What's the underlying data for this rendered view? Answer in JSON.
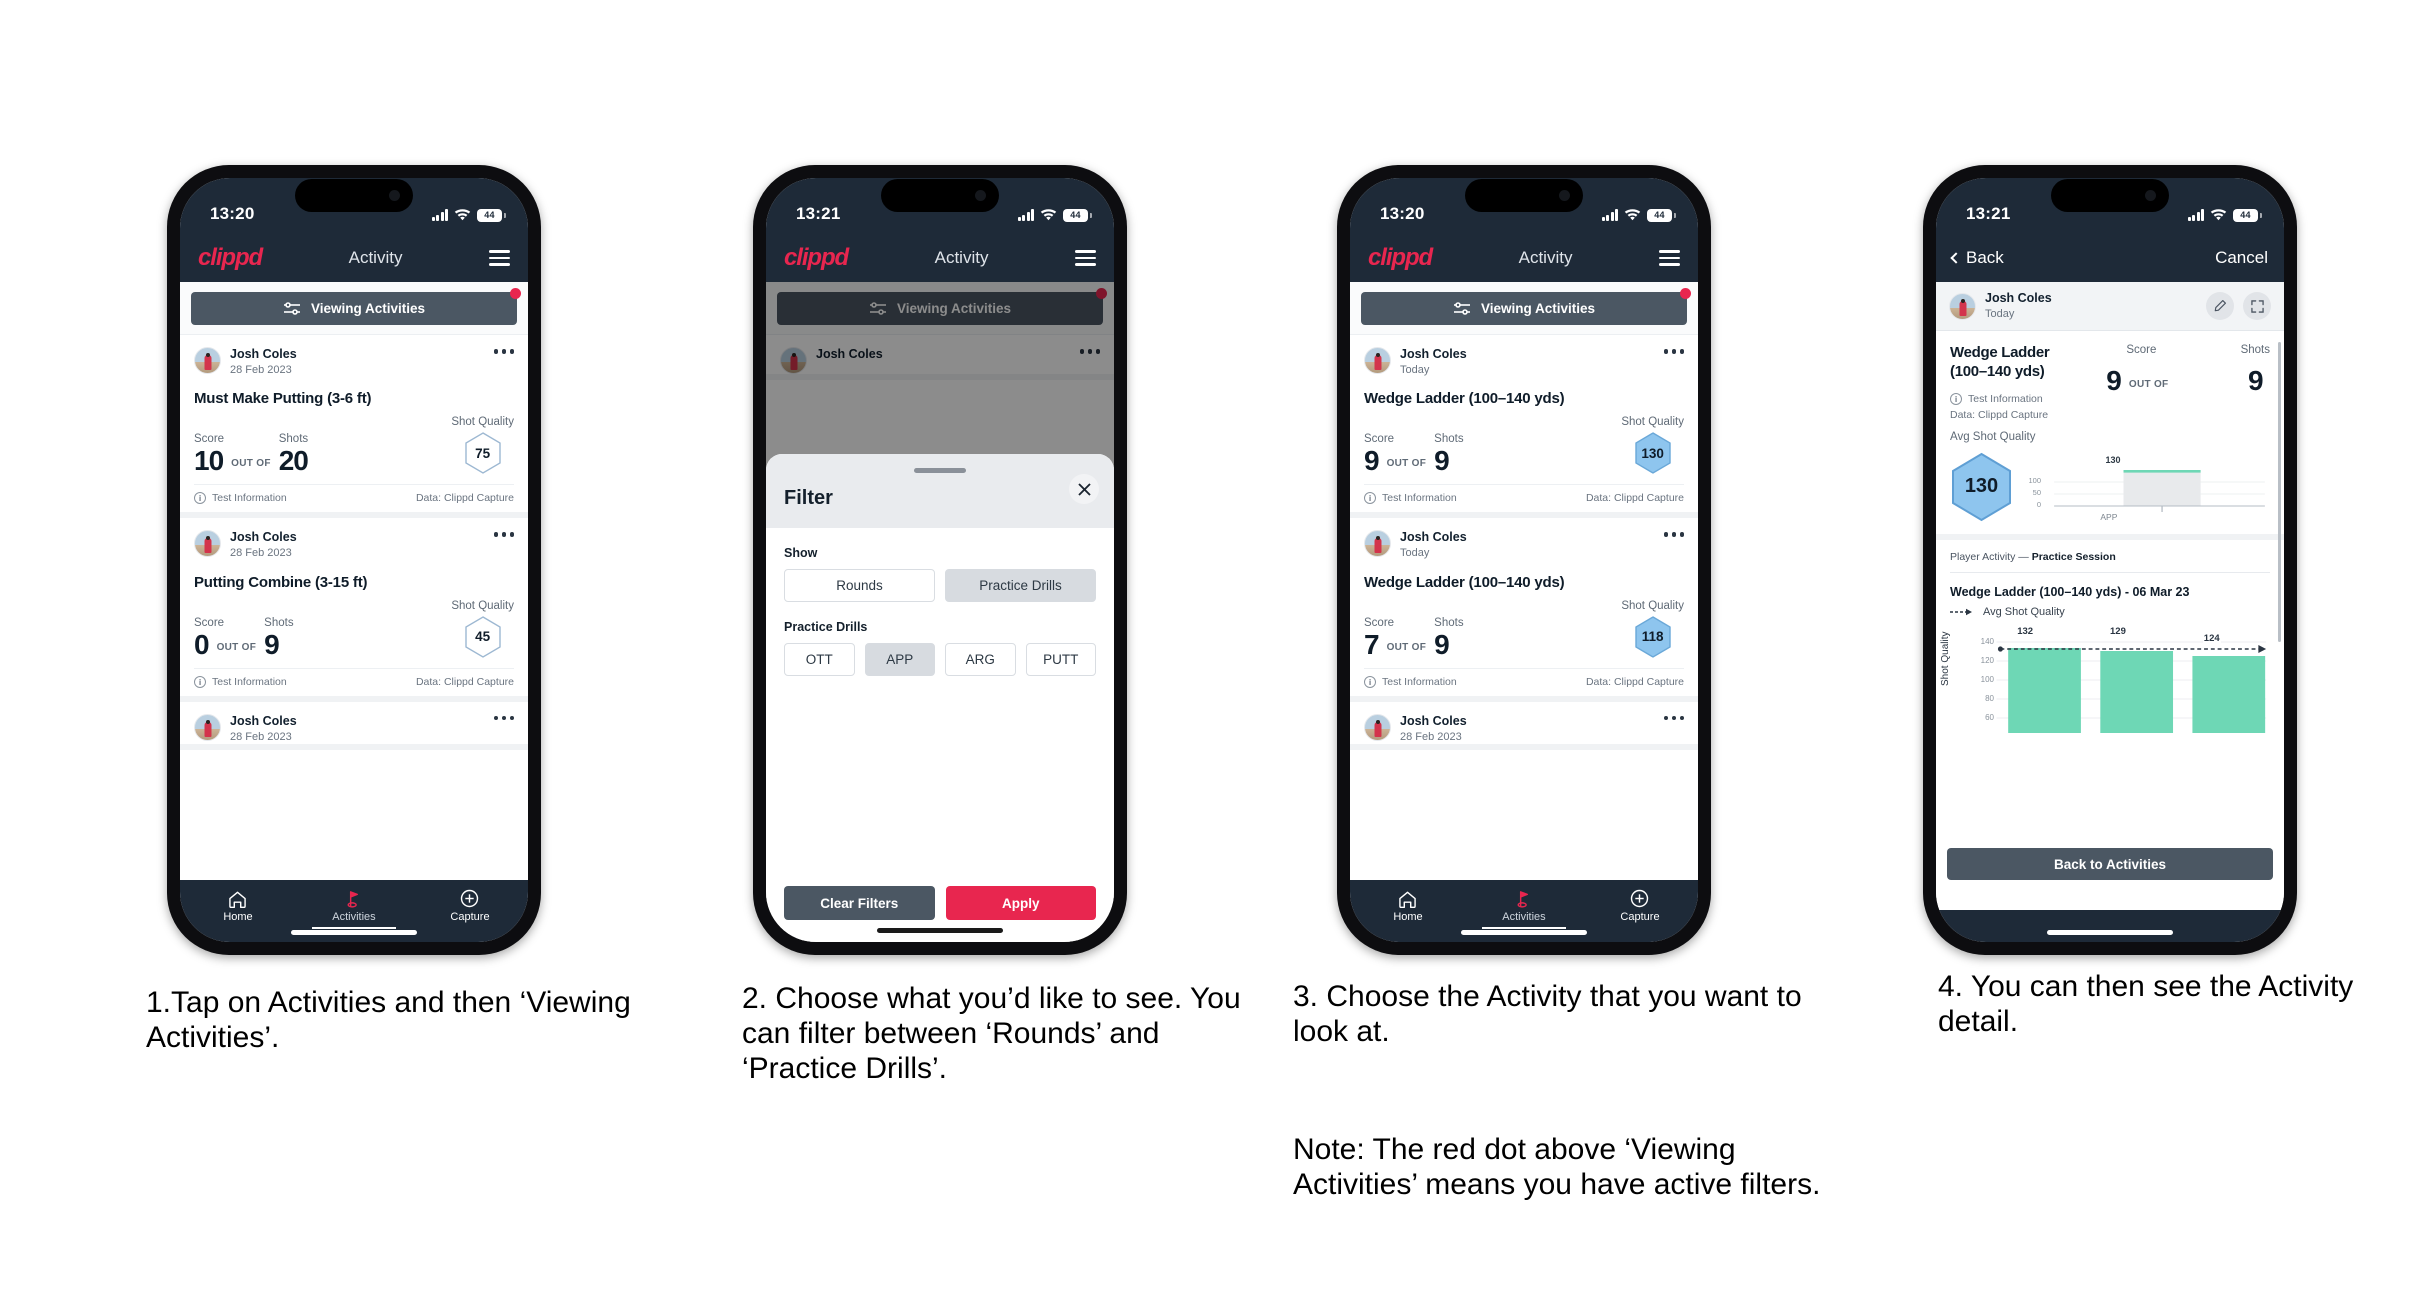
{
  "page": {
    "background": "#ffffff",
    "brand_color": "#e8264f",
    "dark_color": "#1e2a38"
  },
  "phones": [
    {
      "id": "phone-1",
      "status": {
        "time": "13:20",
        "battery": "44"
      },
      "appbar": {
        "logo": "clippd",
        "title": "Activity",
        "menu_icon": "hamburger-icon"
      },
      "filterbar": {
        "label": "Viewing Activities",
        "icon": "sliders-icon",
        "has_badge": true
      },
      "cards": [
        {
          "user": "Josh Coles",
          "date": "28 Feb 2023",
          "title": "Must Make Putting (3-6 ft)",
          "score_label": "Score",
          "score": "10",
          "outof_label": "OUT OF",
          "shots_label": "Shots",
          "shots": "20",
          "quality_label": "Shot Quality",
          "quality": "75",
          "quality_fill": "#ffffff",
          "foot_left": "Test Information",
          "foot_right": "Data: Clippd Capture"
        },
        {
          "user": "Josh Coles",
          "date": "28 Feb 2023",
          "title": "Putting Combine (3-15 ft)",
          "score_label": "Score",
          "score": "0",
          "outof_label": "OUT OF",
          "shots_label": "Shots",
          "shots": "9",
          "quality_label": "Shot Quality",
          "quality": "45",
          "quality_fill": "#ffffff",
          "foot_left": "Test Information",
          "foot_right": "Data: Clippd Capture"
        },
        {
          "user": "Josh Coles",
          "date": "28 Feb 2023"
        }
      ],
      "nav": [
        {
          "label": "Home",
          "icon": "home-icon",
          "active": false
        },
        {
          "label": "Activities",
          "icon": "golf-flag-icon",
          "active": true
        },
        {
          "label": "Capture",
          "icon": "plus-circle-icon",
          "active": false
        }
      ]
    },
    {
      "id": "phone-2",
      "status": {
        "time": "13:21",
        "battery": "44"
      },
      "appbar": {
        "logo": "clippd",
        "title": "Activity",
        "menu_icon": "hamburger-icon"
      },
      "filterbar": {
        "label": "Viewing Activities",
        "icon": "sliders-icon",
        "has_badge": true
      },
      "behind_card": {
        "user": "Josh Coles"
      },
      "sheet": {
        "title": "Filter",
        "close_icon": "close-icon",
        "show_label": "Show",
        "show_options": [
          {
            "label": "Rounds",
            "selected": false
          },
          {
            "label": "Practice Drills",
            "selected": true
          }
        ],
        "drills_label": "Practice Drills",
        "drill_options": [
          {
            "label": "OTT",
            "selected": false
          },
          {
            "label": "APP",
            "selected": true
          },
          {
            "label": "ARG",
            "selected": false
          },
          {
            "label": "PUTT",
            "selected": false
          }
        ],
        "clear_label": "Clear Filters",
        "apply_label": "Apply"
      }
    },
    {
      "id": "phone-3",
      "status": {
        "time": "13:20",
        "battery": "44"
      },
      "appbar": {
        "logo": "clippd",
        "title": "Activity",
        "menu_icon": "hamburger-icon"
      },
      "filterbar": {
        "label": "Viewing Activities",
        "icon": "sliders-icon",
        "has_badge": true
      },
      "cards": [
        {
          "user": "Josh Coles",
          "date": "Today",
          "title": "Wedge Ladder (100–140 yds)",
          "score_label": "Score",
          "score": "9",
          "outof_label": "OUT OF",
          "shots_label": "Shots",
          "shots": "9",
          "quality_label": "Shot Quality",
          "quality": "130",
          "quality_fill": "#8ec5ee",
          "foot_left": "Test Information",
          "foot_right": "Data: Clippd Capture"
        },
        {
          "user": "Josh Coles",
          "date": "Today",
          "title": "Wedge Ladder (100–140 yds)",
          "score_label": "Score",
          "score": "7",
          "outof_label": "OUT OF",
          "shots_label": "Shots",
          "shots": "9",
          "quality_label": "Shot Quality",
          "quality": "118",
          "quality_fill": "#8ec5ee",
          "foot_left": "Test Information",
          "foot_right": "Data: Clippd Capture"
        },
        {
          "user": "Josh Coles",
          "date": "28 Feb 2023"
        }
      ],
      "nav": [
        {
          "label": "Home",
          "icon": "home-icon",
          "active": false
        },
        {
          "label": "Activities",
          "icon": "golf-flag-icon",
          "active": true
        },
        {
          "label": "Capture",
          "icon": "plus-circle-icon",
          "active": false
        }
      ]
    },
    {
      "id": "phone-4",
      "status": {
        "time": "13:21",
        "battery": "44"
      },
      "navbar": {
        "back_label": "Back",
        "cancel_label": "Cancel",
        "back_icon": "chevron-left-icon"
      },
      "detail": {
        "user": "Josh Coles",
        "date": "Today",
        "edit_icon": "pencil-icon",
        "expand_icon": "expand-icon",
        "title_line1": "Wedge Ladder",
        "title_line2": "(100–140 yds)",
        "score_label": "Score",
        "score": "9",
        "outof_label": "OUT OF",
        "shots_label": "Shots",
        "shots": "9",
        "info_text": "Test Information",
        "data_text": "Data: Clippd Capture",
        "avg_label": "Avg Shot Quality",
        "avg_value": "130",
        "player_activity_prefix": "Player Activity — ",
        "player_activity_value": "Practice Session",
        "chart_title": "Wedge Ladder (100–140 yds) - 06 Mar 23",
        "legend_label": "Avg Shot Quality",
        "back_to_activities": "Back to Activities"
      }
    }
  ],
  "chart_data": [
    {
      "type": "bar",
      "id": "avg-shot-quality-mini",
      "categories": [
        "APP"
      ],
      "values": [
        130
      ],
      "data_labels": [
        "130"
      ],
      "title": "",
      "xlabel": "",
      "ylabel": "",
      "ytick_labels": [
        "100",
        "50",
        "0"
      ],
      "ylim": [
        0,
        130
      ],
      "grid": true,
      "bar_color": "#e6e8ea",
      "cap_color": "#6ed7b5"
    },
    {
      "type": "bar",
      "id": "shot-quality-session",
      "categories": [
        "1",
        "2",
        "3"
      ],
      "values": [
        132,
        129,
        124
      ],
      "data_labels": [
        "132",
        "129",
        "124"
      ],
      "title": "Wedge Ladder (100–140 yds) - 06 Mar 23",
      "xlabel": "",
      "ylabel": "Shot Quality",
      "ytick_labels": [
        "140",
        "120",
        "100",
        "80",
        "60"
      ],
      "ylim": [
        50,
        145
      ],
      "grid": true,
      "bar_color": "#6ed7b5",
      "legend": [
        "Avg Shot Quality"
      ],
      "legend_position": "top-left",
      "annotations": [
        {
          "type": "dashed-line",
          "label": "Avg Shot Quality",
          "value": 130
        }
      ]
    }
  ],
  "captions": [
    {
      "id": "caption-1",
      "text": "1.Tap on Activities and then ‘Viewing Activities’."
    },
    {
      "id": "caption-2",
      "text": "2. Choose what you’d like to see. You can filter between ‘Rounds’ and ‘Practice Drills’."
    },
    {
      "id": "caption-3",
      "text": "3. Choose the Activity that you want to look at."
    },
    {
      "id": "caption-3b",
      "text": "Note: The red dot above ‘Viewing Activities’ means you have active filters."
    },
    {
      "id": "caption-4",
      "text": "4. You can then see the Activity detail."
    }
  ]
}
